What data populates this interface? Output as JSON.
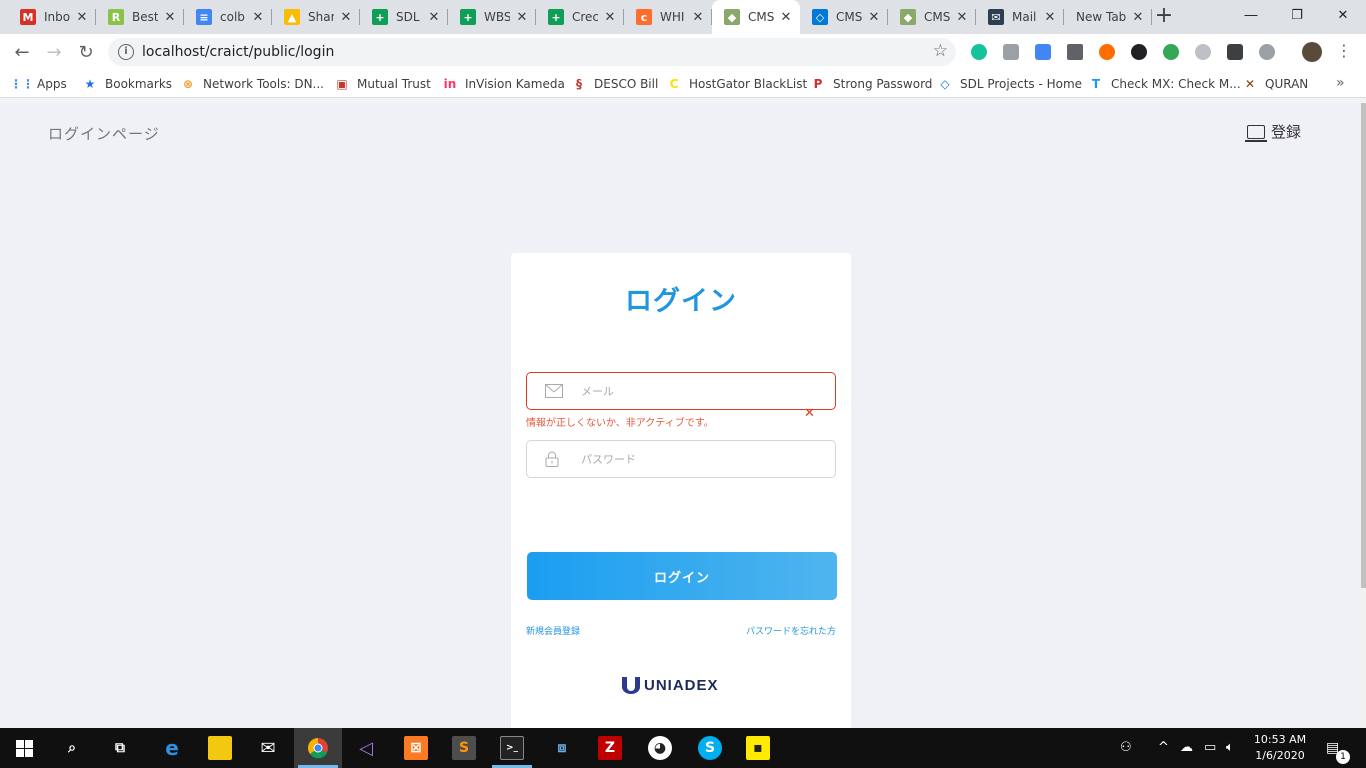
{
  "browser": {
    "tabs": [
      {
        "title": "Inbo",
        "icon": "gmail-icon",
        "color": "#d93025",
        "glyph": "M"
      },
      {
        "title": "Best",
        "icon": "r-app-icon",
        "color": "#8bc34a",
        "glyph": "R"
      },
      {
        "title": "colb",
        "icon": "google-docs-icon",
        "color": "#4285f4",
        "glyph": "≡"
      },
      {
        "title": "Shar",
        "icon": "google-drive-icon",
        "color": "#fbbc04",
        "glyph": "▲"
      },
      {
        "title": "SDL",
        "icon": "google-sheets-icon",
        "color": "#0f9d58",
        "glyph": "+"
      },
      {
        "title": "WBS",
        "icon": "google-sheets-icon",
        "color": "#0f9d58",
        "glyph": "+"
      },
      {
        "title": "Crec",
        "icon": "google-sheets-icon",
        "color": "#0f9d58",
        "glyph": "+"
      },
      {
        "title": "WHI",
        "icon": "cpanel-icon",
        "color": "#ff6c2c",
        "glyph": "c"
      },
      {
        "title": "CMS",
        "icon": "cms-icon",
        "color": "#8aa86a",
        "glyph": "◆"
      },
      {
        "title": "CMS",
        "icon": "azure-devops-icon",
        "color": "#0078d7",
        "glyph": "◇"
      },
      {
        "title": "CMS",
        "icon": "cms-icon",
        "color": "#8aa86a",
        "glyph": "◆"
      },
      {
        "title": "Mail",
        "icon": "mail-icon",
        "color": "#2c3e50",
        "glyph": "✉"
      },
      {
        "title": "New Tab",
        "icon": "",
        "color": "",
        "glyph": ""
      }
    ],
    "active_tab_index": 8,
    "url": "localhost/craict/public/login"
  },
  "bookmarks": [
    {
      "label": "Apps",
      "icon": "apps-grid-icon",
      "color": "#4285f4",
      "glyph": "⋮⋮"
    },
    {
      "label": "Bookmarks",
      "icon": "star-icon",
      "color": "#1a73e8",
      "glyph": "★"
    },
    {
      "label": "Network Tools: DN...",
      "icon": "network-tools-icon",
      "color": "#f0a030",
      "glyph": "⊗"
    },
    {
      "label": "Mutual Trust",
      "icon": "bank-icon",
      "color": "#c0392b",
      "glyph": "▣"
    },
    {
      "label": "InVision Kameda",
      "icon": "invision-icon",
      "color": "#ff3366",
      "glyph": "in"
    },
    {
      "label": "DESCO Bill",
      "icon": "desco-icon",
      "color": "#c0392b",
      "glyph": "§"
    },
    {
      "label": "HostGator BlackList",
      "icon": "hostgator-icon",
      "color": "#f7e400",
      "glyph": "C"
    },
    {
      "label": "Strong Password",
      "icon": "password-icon",
      "color": "#d32f2f",
      "glyph": "P"
    },
    {
      "label": "SDL Projects - Home",
      "icon": "azure-devops-icon",
      "color": "#0078d7",
      "glyph": "◇"
    },
    {
      "label": "Check MX: Check M...",
      "icon": "checkmx-icon",
      "color": "#2196f3",
      "glyph": "T"
    },
    {
      "label": "QURAN",
      "icon": "quran-icon",
      "color": "#7b3f00",
      "glyph": "✕"
    }
  ],
  "page": {
    "heading": "ログインページ",
    "register_label": "登録"
  },
  "login_card": {
    "title": "ログイン",
    "email_placeholder": "メール",
    "email_value": "",
    "error_message": "情報が正しくないか、非アクティブです。",
    "password_placeholder": "パスワード",
    "submit_label": "ログイン",
    "signup_link": "新規会員登録",
    "forgot_link": "パスワードを忘れた方",
    "brand": "UNIADEX",
    "accent_color": "#2196e0",
    "error_color": "#e0391f"
  },
  "taskbar": {
    "time": "10:53 AM",
    "date": "1/6/2020",
    "notification_count": "1"
  }
}
